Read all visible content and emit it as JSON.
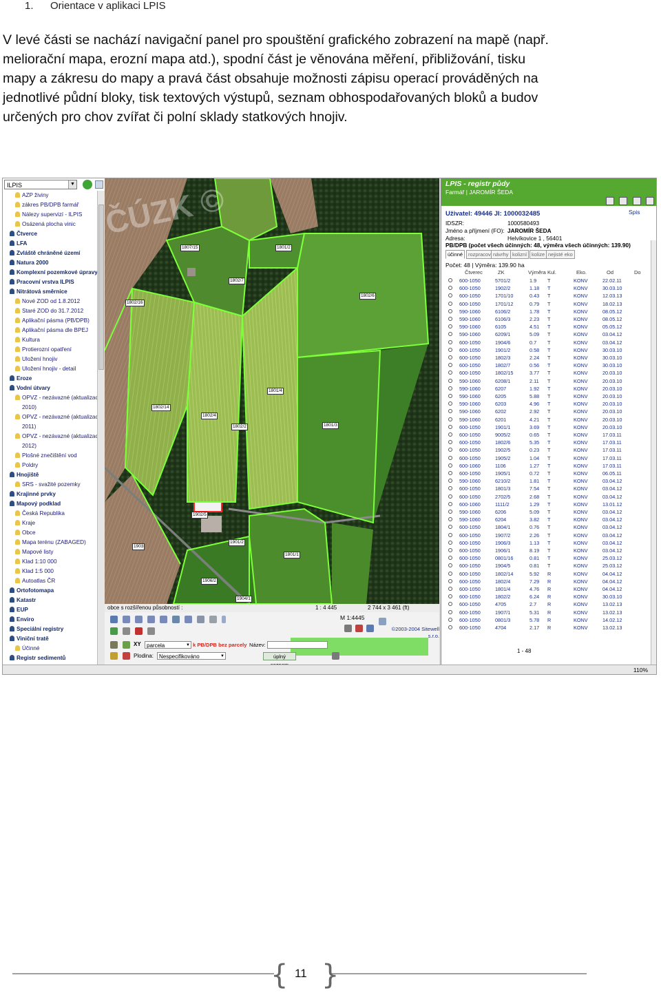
{
  "heading": {
    "number": "1.",
    "text": "Orientace v aplikaci LPIS"
  },
  "paragraph_lines": [
    "V levé části se nachází navigační panel pro spouštění grafického zobrazení na mapě (např.",
    "meliorační mapa, erozní mapa atd.), spodní část je věnována měření, přibližování, tisku",
    "mapy a zákresu do mapy a pravá část obsahuje možnosti zápisu operací prováděných na",
    "jednotlivé půdní bloky, tisk textových výstupů, seznam obhospodařovaných bloků a budov",
    "určených pro chov zvířat či polní sklady statkových hnojiv."
  ],
  "screenshot": {
    "nav": {
      "select_value": "ILPIS",
      "items": [
        {
          "label": "AZP živiny",
          "level": 1
        },
        {
          "label": "zákres PB/DPB farmář",
          "level": 1
        },
        {
          "label": "Nálezy supervizí - ILPIS",
          "level": 1
        },
        {
          "label": "Osázená plocha vinic",
          "level": 1
        },
        {
          "label": "Čtverce",
          "level": 0
        },
        {
          "label": "LFA",
          "level": 0
        },
        {
          "label": "Zvláště chráněné území",
          "level": 0
        },
        {
          "label": "Natura 2000",
          "level": 0
        },
        {
          "label": "Komplexní pozemkové úpravy",
          "level": 0
        },
        {
          "label": "Pracovní vrstva ILPIS",
          "level": 0
        },
        {
          "label": "Nitrátová směrnice",
          "level": 0
        },
        {
          "label": "Nové ZOD od 1.8.2012",
          "level": 1
        },
        {
          "label": "Staré ZOD do 31.7.2012",
          "level": 1
        },
        {
          "label": "Aplikační pásma (PB/DPB)",
          "level": 1
        },
        {
          "label": "Aplikační pásma dle BPEJ",
          "level": 1
        },
        {
          "label": "Kultura",
          "level": 1
        },
        {
          "label": "Protierozní opatření",
          "level": 1
        },
        {
          "label": "Uložení hnojiv",
          "level": 1
        },
        {
          "label": "Uložení hnojiv - detail",
          "level": 1
        },
        {
          "label": "Eroze",
          "level": 0
        },
        {
          "label": "Vodní útvary",
          "level": 0
        },
        {
          "label": "OPVZ - nezávazné (aktualizace",
          "level": 1
        },
        {
          "label": "2010)",
          "level": 2
        },
        {
          "label": "OPVZ - nezávazné (aktualizace",
          "level": 1
        },
        {
          "label": "2011)",
          "level": 2
        },
        {
          "label": "OPVZ - nezávazné (aktualizace",
          "level": 1
        },
        {
          "label": "2012)",
          "level": 2
        },
        {
          "label": "Plošné znečištění vod",
          "level": 1
        },
        {
          "label": "Poldry",
          "level": 1
        },
        {
          "label": "Hnojiště",
          "level": 0
        },
        {
          "label": "SRS - svažité pozemky",
          "level": 1
        },
        {
          "label": "Krajinné prvky",
          "level": 0
        },
        {
          "label": "Mapový podklad",
          "level": 0
        },
        {
          "label": "Česká Republika",
          "level": 1
        },
        {
          "label": "Kraje",
          "level": 1
        },
        {
          "label": "Obce",
          "level": 1
        },
        {
          "label": "Mapa terénu (ZABAGED)",
          "level": 1
        },
        {
          "label": "Mapové listy",
          "level": 1
        },
        {
          "label": "Klad 1:10 000",
          "level": 1
        },
        {
          "label": "Klad 1:5 000",
          "level": 1
        },
        {
          "label": "Autoatlas ČR",
          "level": 1
        },
        {
          "label": "Ortofotomapa",
          "level": 0
        },
        {
          "label": "Katastr",
          "level": 0
        },
        {
          "label": "EUP",
          "level": 0
        },
        {
          "label": "Enviro",
          "level": 0
        },
        {
          "label": "Speciální registry",
          "level": 0
        },
        {
          "label": "Viniční tratě",
          "level": 0
        },
        {
          "label": "Účinné",
          "level": 1
        },
        {
          "label": "Registr sedimentů",
          "level": 0
        }
      ]
    },
    "map": {
      "watermark": "ČÚZK ©",
      "block_labels": [
        "1807/15",
        "1801/2",
        "1802/16",
        "1802/7",
        "1802/6",
        "1801/4",
        "1802/14",
        "1802/4",
        "1802/2",
        "1801/3",
        "1902/5",
        "1901/2",
        "1903",
        "1801/1",
        "1906/2",
        "1904/1"
      ],
      "statusbar": {
        "left": "obce s rozšířenou působností :",
        "scale": "1 : 4 445",
        "size": "2 744 x 3 461 (ft)"
      },
      "toolbar": {
        "measure": "M 1:4445",
        "copyright": "©2003-2004 Sitewell s.r.o.",
        "layer_select": "parcela",
        "layer_text": "k PB/DPB bez parcely",
        "name_label": "Název:",
        "plodina_label": "Plodina:",
        "plodina_value": "Nespecifikováno",
        "full_list_button": "úplný seznam"
      }
    },
    "right": {
      "title": "LPIS - registr půdy",
      "farmer": "Farmář | JAROMÍR ŠEDA",
      "user": "Uživatel: 49446 JI: 1000032485",
      "spis": "Spis",
      "info": [
        {
          "label": "IDSZR:",
          "value": "1000580493"
        },
        {
          "label": "Jméno a příjmení (FO):",
          "value": "JAROMÍR ŠEDA"
        },
        {
          "label": "Adresa:",
          "value": "Helvíkovice 1 , 56401"
        }
      ],
      "pbdpb": "PB/DPB (počet všech účinných: 48, výměra všech účinných: 139.90)",
      "tabs": [
        "účinné",
        "rozpracované",
        "návrhy",
        "kolizní",
        "kolize",
        "nejisté eko"
      ],
      "count": "Počet: 48 | Výměra: 139.90 ha",
      "columns": [
        "Čtverec",
        "ZK",
        "Výměra",
        "Kul.",
        "Eko.",
        "Od",
        "Do"
      ],
      "rows": [
        [
          "600-1050",
          "5701/2",
          "1.9",
          "T",
          "KONV",
          "22.02.11"
        ],
        [
          "600-1050",
          "1902/2",
          "1.18",
          "T",
          "KONV",
          "30.03.10"
        ],
        [
          "600-1050",
          "1701/10",
          "0.43",
          "T",
          "KONV",
          "12.03.13"
        ],
        [
          "600-1050",
          "1701/12",
          "0.79",
          "T",
          "KONV",
          "18.02.13"
        ],
        [
          "590-1060",
          "6106/2",
          "1.78",
          "T",
          "KONV",
          "08.05.12"
        ],
        [
          "590-1060",
          "6106/3",
          "2.23",
          "T",
          "KONV",
          "08.05.12"
        ],
        [
          "590-1060",
          "6105",
          "4.51",
          "T",
          "KONV",
          "05.05.12"
        ],
        [
          "590-1060",
          "6209/1",
          "5.09",
          "T",
          "KONV",
          "03.04.12"
        ],
        [
          "600-1050",
          "1904/6",
          "0.7",
          "T",
          "KONV",
          "03.04.12"
        ],
        [
          "600-1050",
          "1901/2",
          "0.58",
          "T",
          "KONV",
          "30.03.10"
        ],
        [
          "600-1050",
          "1802/3",
          "2.24",
          "T",
          "KONV",
          "30.03.10"
        ],
        [
          "600-1050",
          "1802/7",
          "0.56",
          "T",
          "KONV",
          "30.03.10"
        ],
        [
          "600-1050",
          "1802/15",
          "3.77",
          "T",
          "KONV",
          "20.03.10"
        ],
        [
          "590-1060",
          "6208/1",
          "2.11",
          "T",
          "KONV",
          "20.03.10"
        ],
        [
          "590-1060",
          "6207",
          "1.92",
          "T",
          "KONV",
          "20.03.10"
        ],
        [
          "590-1060",
          "6205",
          "5.88",
          "T",
          "KONV",
          "20.03.10"
        ],
        [
          "590-1060",
          "6203",
          "4.96",
          "T",
          "KONV",
          "20.03.10"
        ],
        [
          "590-1060",
          "6202",
          "2.92",
          "T",
          "KONV",
          "20.03.10"
        ],
        [
          "590-1060",
          "6201",
          "4.21",
          "T",
          "KONV",
          "20.03.10"
        ],
        [
          "600-1050",
          "1901/1",
          "3.69",
          "T",
          "KONV",
          "20.03.10"
        ],
        [
          "600-1050",
          "9005/2",
          "0.65",
          "T",
          "KONV",
          "17.03.11"
        ],
        [
          "600-1050",
          "1802/6",
          "5.35",
          "T",
          "KONV",
          "17.03.11"
        ],
        [
          "600-1050",
          "1902/5",
          "0.23",
          "T",
          "KONV",
          "17.03.11"
        ],
        [
          "600-1050",
          "1905/2",
          "1.04",
          "T",
          "KONV",
          "17.03.11"
        ],
        [
          "600-1060",
          "1106",
          "1.27",
          "T",
          "KONV",
          "17.03.11"
        ],
        [
          "600-1050",
          "1905/1",
          "0.72",
          "T",
          "KONV",
          "06.05.11"
        ],
        [
          "590-1060",
          "6210/2",
          "1.81",
          "T",
          "KONV",
          "03.04.12"
        ],
        [
          "600-1050",
          "1801/3",
          "7.54",
          "T",
          "KONV",
          "03.04.12"
        ],
        [
          "600-1050",
          "2702/5",
          "2.68",
          "T",
          "KONV",
          "03.04.12"
        ],
        [
          "600-1060",
          "1111/2",
          "1.29",
          "T",
          "KONV",
          "13.01.12"
        ],
        [
          "590-1060",
          "6206",
          "5.09",
          "T",
          "KONV",
          "03.04.12"
        ],
        [
          "590-1060",
          "6204",
          "3.82",
          "T",
          "KONV",
          "03.04.12"
        ],
        [
          "600-1050",
          "1804/1",
          "0.76",
          "T",
          "KONV",
          "03.04.12"
        ],
        [
          "600-1050",
          "1907/2",
          "2.26",
          "T",
          "KONV",
          "03.04.12"
        ],
        [
          "600-1050",
          "1906/3",
          "1.13",
          "T",
          "KONV",
          "03.04.12"
        ],
        [
          "600-1050",
          "1906/1",
          "8.19",
          "T",
          "KONV",
          "03.04.12"
        ],
        [
          "600-1050",
          "0801/16",
          "0.81",
          "T",
          "KONV",
          "25.03.12"
        ],
        [
          "600-1050",
          "1904/5",
          "0.81",
          "T",
          "KONV",
          "25.03.12"
        ],
        [
          "600-1050",
          "1802/14",
          "5.92",
          "R",
          "KONV",
          "04.04.12"
        ],
        [
          "600-1050",
          "1802/4",
          "7.29",
          "R",
          "KONV",
          "04.04.12"
        ],
        [
          "600-1050",
          "1801/4",
          "4.76",
          "R",
          "KONV",
          "04.04.12"
        ],
        [
          "600-1050",
          "1802/2",
          "6.24",
          "R",
          "KONV",
          "30.03.10"
        ],
        [
          "600-1050",
          "4705",
          "2.7",
          "R",
          "KONV",
          "13.02.13"
        ],
        [
          "600-1050",
          "1907/1",
          "5.31",
          "R",
          "KONV",
          "13.02.13"
        ],
        [
          "600-1050",
          "0801/3",
          "5.78",
          "R",
          "KONV",
          "14.02.12"
        ],
        [
          "600-1050",
          "4704",
          "2.17",
          "R",
          "KONV",
          "13.02.13"
        ]
      ],
      "pager": "1 - 48"
    },
    "zoom": "110%"
  },
  "page_number": "11"
}
